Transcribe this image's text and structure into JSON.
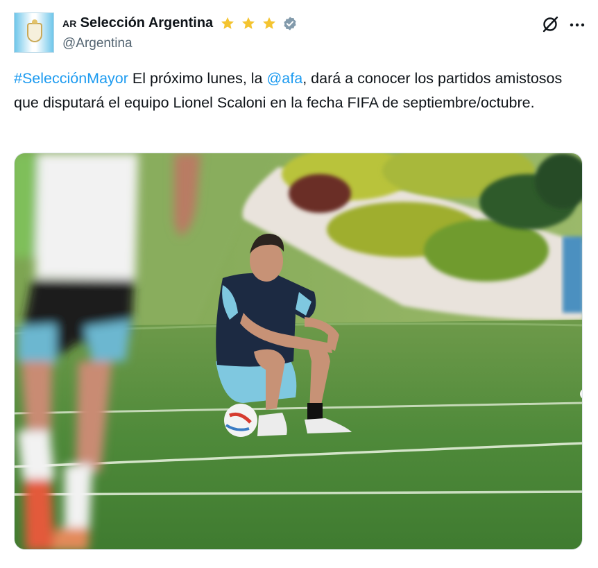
{
  "author": {
    "flag_code": "AR",
    "display_name": "Selección Argentina",
    "handle": "@Argentina",
    "badges": [
      "star-icon",
      "star-icon",
      "star-icon",
      "verified-badge-icon"
    ]
  },
  "actions": {
    "grok_icon": "grok-icon",
    "more_icon": "more-options-icon"
  },
  "tweet": {
    "hashtag": "#SelecciónMayor",
    "text_part1": " El próximo lunes, la ",
    "mention": "@afa",
    "text_part2": ", dará a conocer los partidos amistosos que disputará el equipo Lionel Scaloni en la fecha FIFA de septiembre/octubre."
  },
  "colors": {
    "link": "#1d9bf0",
    "text": "#0f1419",
    "secondary": "#536471",
    "star": "#f4c430",
    "verified": "#829aab",
    "pitch": "#4f8a3a"
  }
}
